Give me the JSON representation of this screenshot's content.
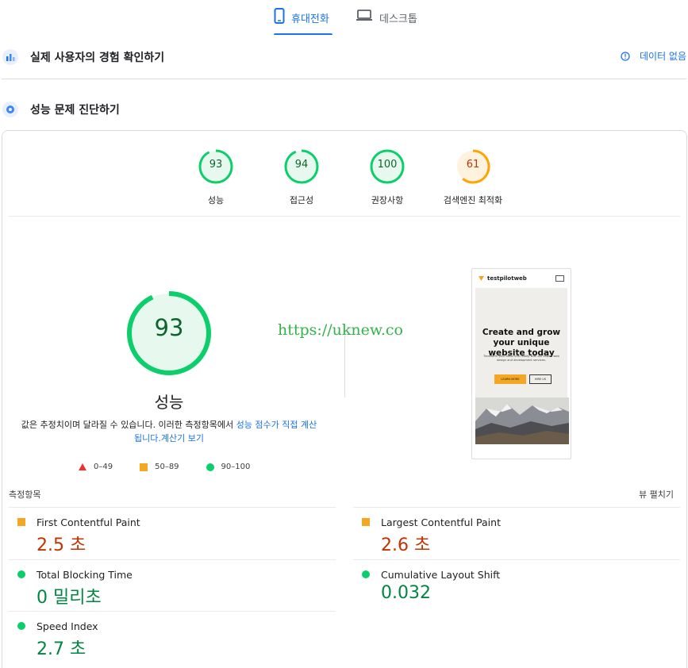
{
  "tabs": [
    {
      "label": "휴대전화",
      "icon": "phone-icon",
      "active": true
    },
    {
      "label": "데스크톱",
      "icon": "laptop-icon",
      "active": false
    }
  ],
  "crux": {
    "title": "실제 사용자의 경험 확인하기",
    "no_data_label": "데이터 없음",
    "icon": "users-chart-icon"
  },
  "lab": {
    "title": "성능 문제 진단하기",
    "icon": "lighthouse-icon"
  },
  "categories": [
    {
      "label": "성능",
      "score": "93",
      "score_value": 93,
      "status": "pass"
    },
    {
      "label": "접근성",
      "score": "94",
      "score_value": 94,
      "status": "pass"
    },
    {
      "label": "권장사항",
      "score": "100",
      "score_value": 100,
      "status": "pass"
    },
    {
      "label": "검색엔진 최적화",
      "score": "61",
      "score_value": 61,
      "status": "average"
    }
  ],
  "main_score": {
    "value": "93",
    "value_num": 93,
    "label": "성능"
  },
  "note": {
    "text": "값은 추정치이며 달라질 수 있습니다. 이러한 측정항목에서 ",
    "link1": "성능 점수가 직접 계산됩니다.",
    "link2": "계산기 보기"
  },
  "legend": [
    {
      "range": "0–49",
      "shape": "triangle",
      "color": "#eb3131"
    },
    {
      "range": "50–89",
      "shape": "square",
      "color": "#f5a623"
    },
    {
      "range": "90–100",
      "shape": "circle",
      "color": "#0cce6b"
    }
  ],
  "watermark": "https://uknew.co",
  "screenshot": {
    "brand": "testpilotweb",
    "headline": "Create and grow your unique website today",
    "subtext": "Transform your ideas into reality with our expert web design and development services.",
    "btn_primary": "LEARN MORE",
    "btn_secondary": "HIRE US"
  },
  "metrics_header": {
    "label": "측정항목",
    "expand": "뷰 펼치기"
  },
  "metrics": [
    {
      "name": "First Contentful Paint",
      "value": "2.5 초",
      "status": "average"
    },
    {
      "name": "Largest Contentful Paint",
      "value": "2.6 초",
      "status": "average"
    },
    {
      "name": "Total Blocking Time",
      "value": "0 밀리초",
      "status": "pass"
    },
    {
      "name": "Cumulative Layout Shift",
      "value": "0.032",
      "status": "pass"
    },
    {
      "name": "Speed Index",
      "value": "2.7 초",
      "status": "pass"
    }
  ],
  "colors": {
    "accent": "#1a73e8",
    "pass": "#0cce6b",
    "average": "#ffa400",
    "fail": "#eb3131"
  }
}
